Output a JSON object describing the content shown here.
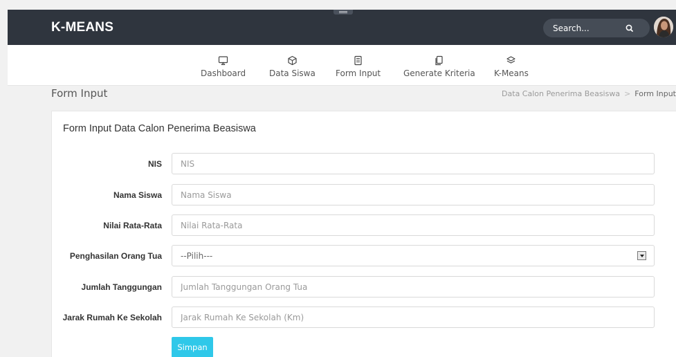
{
  "header": {
    "brand": "K-MEANS",
    "search_placeholder": "Search..."
  },
  "nav": [
    {
      "label": "Dashboard",
      "icon": "monitor-icon"
    },
    {
      "label": "Data Siswa",
      "icon": "cube-icon"
    },
    {
      "label": "Form Input",
      "icon": "document-icon"
    },
    {
      "label": "Generate Kriteria",
      "icon": "copy-icon"
    },
    {
      "label": "K-Means",
      "icon": "layers-icon"
    }
  ],
  "page": {
    "title": "Form Input",
    "breadcrumb": [
      "Data Calon Penerima Beasiswa",
      "Form Input"
    ]
  },
  "form": {
    "title": "Form Input Data Calon Penerima Beasiswa",
    "fields": [
      {
        "label": "NIS",
        "placeholder": "NIS",
        "value": ""
      },
      {
        "label": "Nama Siswa",
        "placeholder": "Nama Siswa",
        "value": ""
      },
      {
        "label": "Nilai Rata-Rata",
        "placeholder": "Nilai Rata-Rata",
        "value": ""
      },
      {
        "label": "Penghasilan Orang Tua",
        "selected": "--Pilih---"
      },
      {
        "label": "Jumlah Tanggungan",
        "placeholder": "Jumlah Tanggungan Orang Tua",
        "value": ""
      },
      {
        "label": "Jarak Rumah Ke Sekolah",
        "placeholder": "Jarak Rumah Ke Sekolah (Km)",
        "value": ""
      }
    ],
    "submit_label": "Simpan"
  },
  "colors": {
    "topbar": "#2f353e",
    "accent": "#2fc8e9",
    "background": "#f1f1f1"
  }
}
